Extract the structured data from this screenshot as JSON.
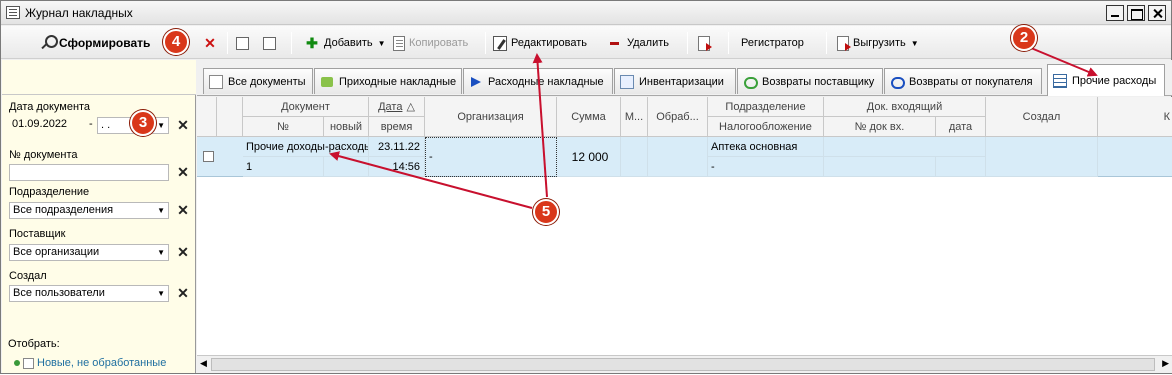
{
  "window": {
    "title": "Журнал накладных"
  },
  "toolbar": {
    "generate": "Сформировать",
    "add": "Добавить",
    "copy": "Копировать",
    "edit": "Редактировать",
    "delete": "Удалить",
    "registrar": "Регистратор",
    "export": "Выгрузить"
  },
  "badges": {
    "b2": "2",
    "b3": "3",
    "b4": "4",
    "b5": "5"
  },
  "tabs": [
    {
      "label": "Все документы"
    },
    {
      "label": "Приходные накладные"
    },
    {
      "label": "Расходные накладные"
    },
    {
      "label": "Инвентаризации"
    },
    {
      "label": "Возвраты поставщику"
    },
    {
      "label": "Возвраты от покупателя"
    },
    {
      "label": "Прочие расходы",
      "active": true
    }
  ],
  "filters": {
    "date_label": "Дата документа",
    "date_from": "01.09.2022",
    "date_to": ". .",
    "dash": "-",
    "doc_number_label": "№ документа",
    "doc_number_value": "",
    "department_label": "Подразделение",
    "department_value": "Все подразделения",
    "supplier_label": "Поставщик",
    "supplier_value": "Все организации",
    "creator_label": "Создал",
    "creator_value": "Все пользователи",
    "show_label": "Отобрать:",
    "show_option": "Новые, не обработанные"
  },
  "grid": {
    "headers": {
      "document": "Документ",
      "number": "№",
      "new": "новый",
      "date": "Дата",
      "sort": "△",
      "time": "время",
      "organization": "Организация",
      "sum": "Сумма",
      "m": "М...",
      "processed": "Обраб...",
      "department": "Подразделение",
      "taxation": "Налогообложение",
      "incoming": "Док. входящий",
      "incoming_number": "№ док вх.",
      "incoming_date": "дата",
      "created": "Создал",
      "k": "К"
    },
    "row": {
      "doc_type": "Прочие доходы-расходы",
      "number": "1",
      "date": "23.11.22",
      "time": "14:56",
      "organization": "-",
      "sum": "12 000",
      "department": "Аптека основная",
      "taxation": "-"
    }
  }
}
